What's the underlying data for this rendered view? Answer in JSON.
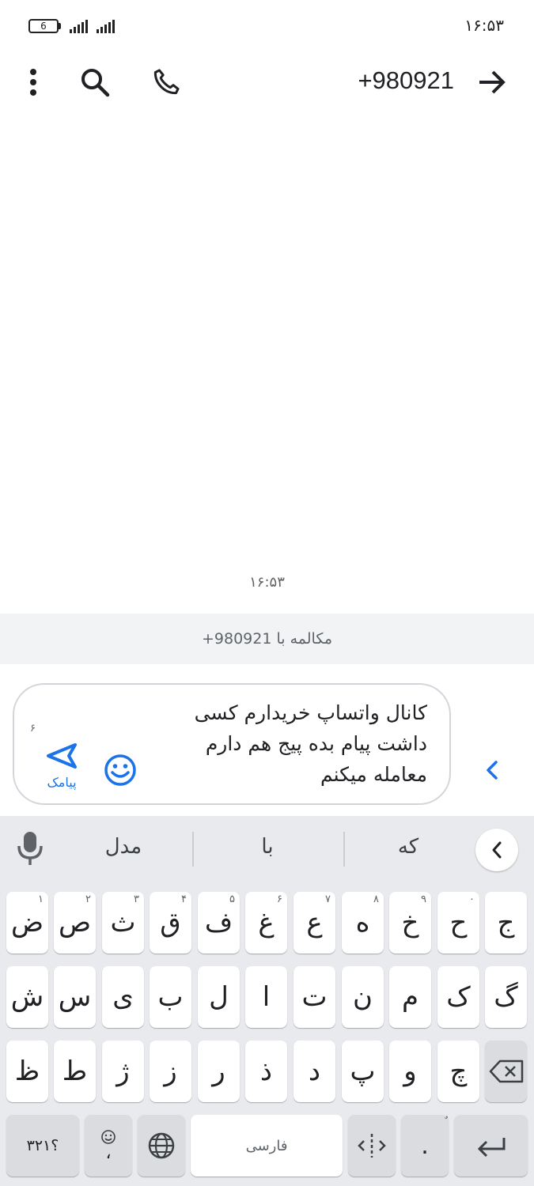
{
  "status_bar": {
    "battery_level": "6",
    "time": "۱۶:۵۳"
  },
  "toolbar": {
    "contact_number": "+980921",
    "icons": [
      "back-arrow-icon",
      "phone-icon",
      "search-icon",
      "more-vert-icon"
    ]
  },
  "conversation": {
    "message_time": "۱۶:۵۳",
    "strip_text": "مکالمه با 980921+"
  },
  "compose": {
    "text_line1": "کانال واتساپ خریدارم کسی",
    "text_line2": "داشت پیام بده پیج هم دارم",
    "text_line3": "معامله میکنم",
    "char_count": "۶",
    "send_label": "پیامک",
    "accent": "#1a73e8"
  },
  "keyboard": {
    "suggestions": [
      "که",
      "با",
      "مدل"
    ],
    "row1": [
      {
        "k": "ج",
        "h": ""
      },
      {
        "k": "ح",
        "h": "۰"
      },
      {
        "k": "خ",
        "h": "۹"
      },
      {
        "k": "ه",
        "h": "۸"
      },
      {
        "k": "ع",
        "h": "۷"
      },
      {
        "k": "غ",
        "h": "۶"
      },
      {
        "k": "ف",
        "h": "۵"
      },
      {
        "k": "ق",
        "h": "۴"
      },
      {
        "k": "ث",
        "h": "۳"
      },
      {
        "k": "ص",
        "h": "۲"
      },
      {
        "k": "ض",
        "h": "۱"
      }
    ],
    "row2": [
      "گ",
      "ک",
      "م",
      "ن",
      "ت",
      "ا",
      "ل",
      "ب",
      "ی",
      "س",
      "ش"
    ],
    "row3": [
      "چ",
      "و",
      "پ",
      "د",
      "ذ",
      "ر",
      "ز",
      "ژ",
      "ط",
      "ظ"
    ],
    "row4": {
      "numbers": "؟۳۲۱",
      "emoji_comma": "،",
      "space": "فارسی",
      "period": ".",
      "period_hint": "ٌ"
    }
  }
}
